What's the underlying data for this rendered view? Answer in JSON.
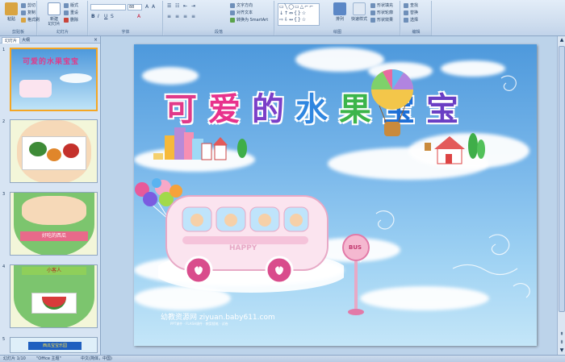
{
  "ribbon": {
    "clipboard": {
      "paste": "粘贴",
      "cut": "剪切",
      "copy": "复制",
      "format_painter": "格式刷",
      "label": "剪贴板"
    },
    "slides": {
      "new_slide": "新建\n幻灯片",
      "layout": "版式",
      "reset": "重设",
      "delete": "删除",
      "label": "幻灯片"
    },
    "font": {
      "size_value": "88",
      "label": "字体"
    },
    "paragraph": {
      "text_direction": "文字方向",
      "align_text": "对齐文本",
      "smartart": "转换为 SmartArt",
      "label": "段落"
    },
    "drawing": {
      "arrange": "排列",
      "quick_styles": "快速样式",
      "shape_fill": "形状填充",
      "shape_outline": "形状轮廓",
      "shape_effects": "形状效果",
      "label": "绘图"
    },
    "editing": {
      "find": "查找",
      "replace": "替换",
      "select": "选择",
      "label": "编辑"
    }
  },
  "pane": {
    "tab_slides": "幻灯片",
    "tab_outline": "大纲",
    "close": "×",
    "thumbs": [
      {
        "num": "1",
        "selected": true
      },
      {
        "num": "2",
        "selected": false
      },
      {
        "num": "3",
        "selected": false,
        "caption": "好吃的西瓜"
      },
      {
        "num": "4",
        "selected": false,
        "caption": "小客人"
      },
      {
        "num": "5",
        "selected": false,
        "caption": "西瓜宝宝乐园"
      }
    ]
  },
  "slide": {
    "title_chars": [
      "可",
      "爱",
      "的",
      "水",
      "果",
      "宝",
      "宝"
    ],
    "title_colors": [
      "#e03a8a",
      "#e8328c",
      "#7b3fc8",
      "#2f86e0",
      "#3cb54a",
      "#1e6fd6",
      "#6a3ec4"
    ],
    "bus_text": "HAPPY",
    "bus_stop_text": "BUS",
    "watermark": "幼教资源网 ziyuan.baby611.com",
    "watermark_sub": "PPT课件 · FLASH课件 · 教案随笔 · 试卷"
  },
  "status": {
    "slide_counter": "幻灯片 1/10",
    "theme": "\"Office 主题\"",
    "language": "中文(简体，中国)"
  }
}
